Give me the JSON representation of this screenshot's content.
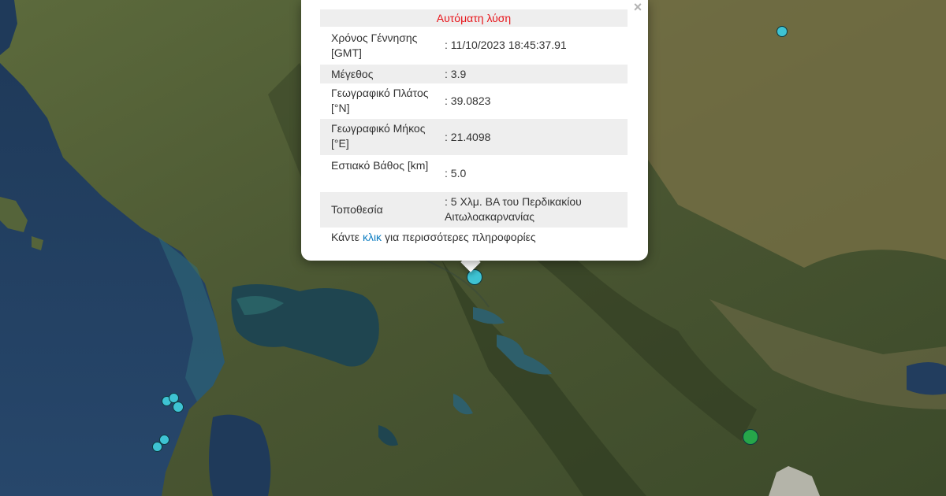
{
  "popup": {
    "title": "Αυτόματη λύση",
    "close_symbol": "×",
    "rows": [
      {
        "label": "Χρόνος Γέννησης [GMT]",
        "value": ": 11/10/2023 18:45:37.91"
      },
      {
        "label": "Μέγεθος",
        "value": ": 3.9"
      },
      {
        "label": "Γεωγραφικό Πλάτος [°N]",
        "value": ": 39.0823"
      },
      {
        "label": "Γεωγραφικό Μήκος [°E]",
        "value": ": 21.4098"
      },
      {
        "label": "Εστιακό Βάθος [km]",
        "value": ": 5.0"
      },
      {
        "label": "Τοποθεσία",
        "value": ": 5 Χλμ. ΒΑ του Περδικακίου Αιτωλοακαρνανίας"
      }
    ],
    "footer": {
      "prefix": "Κάντε",
      "link": "κλικ",
      "suffix": "για περισσότερες πληροφορίες"
    }
  },
  "colors": {
    "title_red": "#e8141a",
    "link_blue": "#0f7ec2",
    "marker_cyan": "#3ec3d3",
    "marker_green": "#26a64a",
    "sea": "#223d5e",
    "land": "#4e5a34"
  },
  "markers": [
    {
      "kind": "selected-epicenter",
      "color": "#3ec3d3"
    },
    {
      "kind": "epicenter",
      "color": "#3ec3d3"
    },
    {
      "kind": "epicenter",
      "color": "#3ec3d3"
    },
    {
      "kind": "epicenter",
      "color": "#3ec3d3"
    },
    {
      "kind": "epicenter",
      "color": "#3ec3d3"
    },
    {
      "kind": "epicenter",
      "color": "#3ec3d3"
    },
    {
      "kind": "epicenter",
      "color": "#3ec3d3"
    },
    {
      "kind": "epicenter",
      "color": "#26a64a"
    }
  ]
}
